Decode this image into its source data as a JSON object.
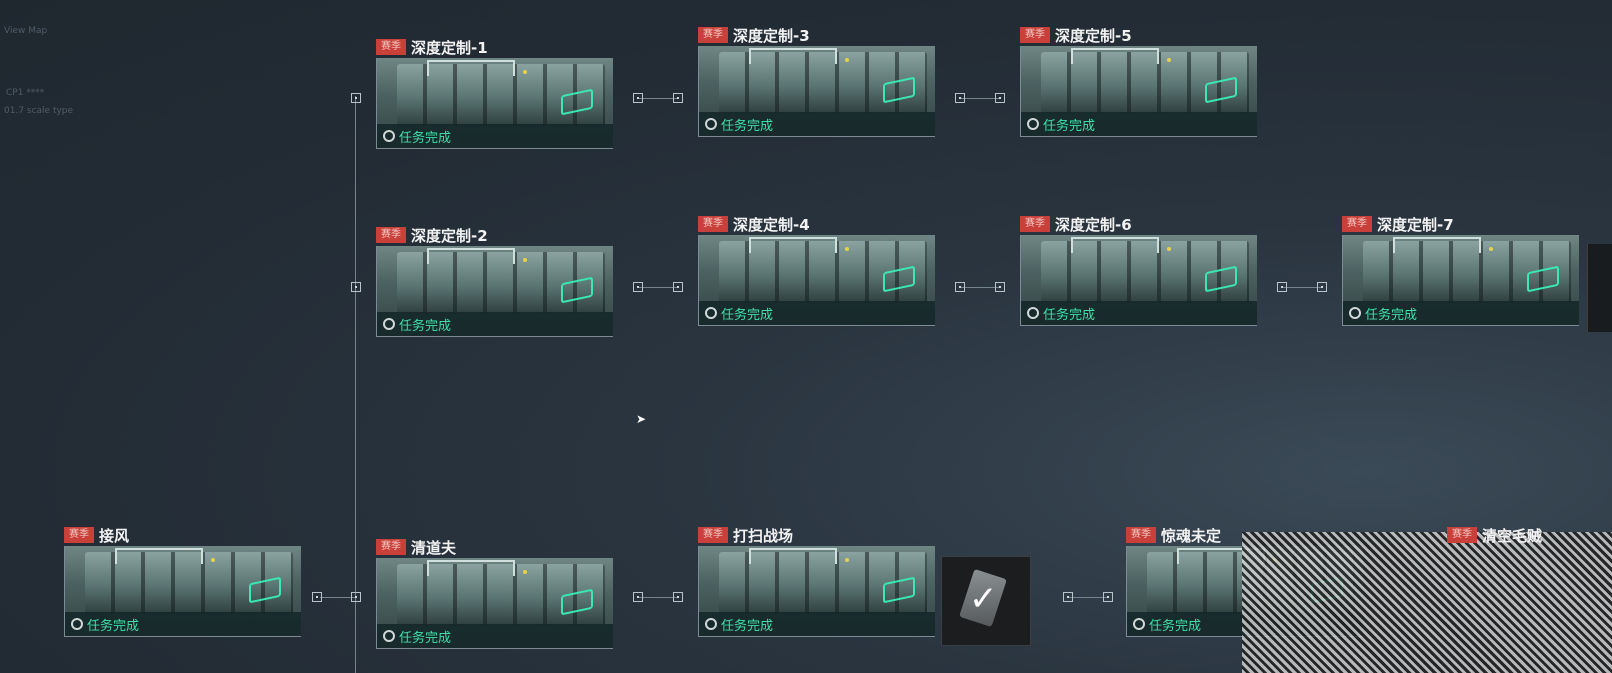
{
  "background_hint": {
    "text1": "View Map",
    "text2": "CP1 ****",
    "text3": "01.7  scale type"
  },
  "missions": [
    {
      "id": "jiefeng",
      "tag": "赛季",
      "title": "接风",
      "status": "任务完成"
    },
    {
      "id": "s1",
      "tag": "赛季",
      "title": "深度定制-1",
      "status": "任务完成"
    },
    {
      "id": "s2",
      "tag": "赛季",
      "title": "深度定制-2",
      "status": "任务完成"
    },
    {
      "id": "s3",
      "tag": "赛季",
      "title": "深度定制-3",
      "status": "任务完成"
    },
    {
      "id": "s4",
      "tag": "赛季",
      "title": "深度定制-4",
      "status": "任务完成"
    },
    {
      "id": "s5",
      "tag": "赛季",
      "title": "深度定制-5",
      "status": "任务完成"
    },
    {
      "id": "s6",
      "tag": "赛季",
      "title": "深度定制-6",
      "status": "任务完成"
    },
    {
      "id": "s7",
      "tag": "赛季",
      "title": "深度定制-7",
      "status": "任务完成"
    },
    {
      "id": "qingdaofu",
      "tag": "赛季",
      "title": "清道夫",
      "status": "任务完成"
    },
    {
      "id": "dasao",
      "tag": "赛季",
      "title": "打扫战场",
      "status": "任务完成"
    },
    {
      "id": "jinghun",
      "tag": "赛季",
      "title": "惊魂未定",
      "status": "任务完成"
    },
    {
      "id": "qingkong",
      "tag": "赛季",
      "title": "清空毛贼",
      "status": ""
    }
  ],
  "reward": {
    "icon": "card-check-icon",
    "state": "claimed"
  },
  "colors": {
    "tag_bg": "#c9403a",
    "status_green": "#3ee0a8",
    "slot_accent": "#3be8b4"
  }
}
